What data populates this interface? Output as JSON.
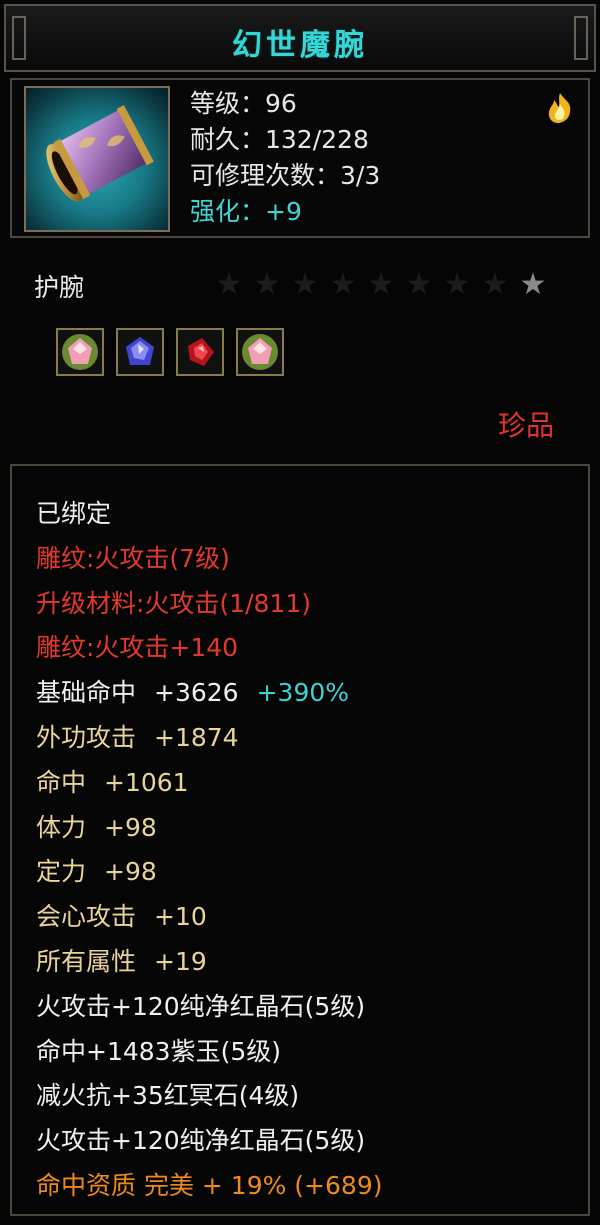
{
  "title": "幻世魔腕",
  "item": {
    "icon": "bracer-icon",
    "level": "等级：96",
    "durability": "耐久：132/228",
    "repairs": "可修理次数：3/3",
    "enhance": "强化：+9",
    "element_icon": "fire-element-icon"
  },
  "type_label": "护腕",
  "stars": {
    "total": 9,
    "lit": 1
  },
  "gems": [
    {
      "name": "pink-gem-icon",
      "color": "#e88aa0"
    },
    {
      "name": "purple-gem-icon",
      "color": "#5a5ae0"
    },
    {
      "name": "red-gem-icon",
      "color": "#d4242c"
    },
    {
      "name": "pink-gem-icon",
      "color": "#e88aa0"
    }
  ],
  "rarity": "珍品",
  "attributes": {
    "bound": "已绑定",
    "engrave": "雕纹:火攻击(7级)",
    "upgrade_material": "升级材料:火攻击(1/811)",
    "engrave_bonus": "雕纹:火攻击+140",
    "base_hit_label": "基础命中",
    "base_hit_value": "+3626",
    "base_hit_pct": "+390%",
    "ext_attack_label": "外功攻击",
    "ext_attack_value": "+1874",
    "hit_label": "命中",
    "hit_value": "+1061",
    "stamina_label": "体力",
    "stamina_value": "+98",
    "focus_label": "定力",
    "focus_value": "+98",
    "crit_label": "会心攻击",
    "crit_value": "+10",
    "all_attr_label": "所有属性",
    "all_attr_value": "+19",
    "gem1": "火攻击+120纯净红晶石(5级)",
    "gem2": "命中+1483紫玉(5级)",
    "gem3": "减火抗+35红冥石(4级)",
    "gem4": "火攻击+120纯净红晶石(5级)",
    "quality": "命中资质 完美 + 19% (+689)"
  },
  "colors": {
    "title": "#34d6d6",
    "red": "#e13a2c",
    "gold": "#e9d49a",
    "orange": "#ec8a1e",
    "cyan": "#3fd1cf"
  }
}
